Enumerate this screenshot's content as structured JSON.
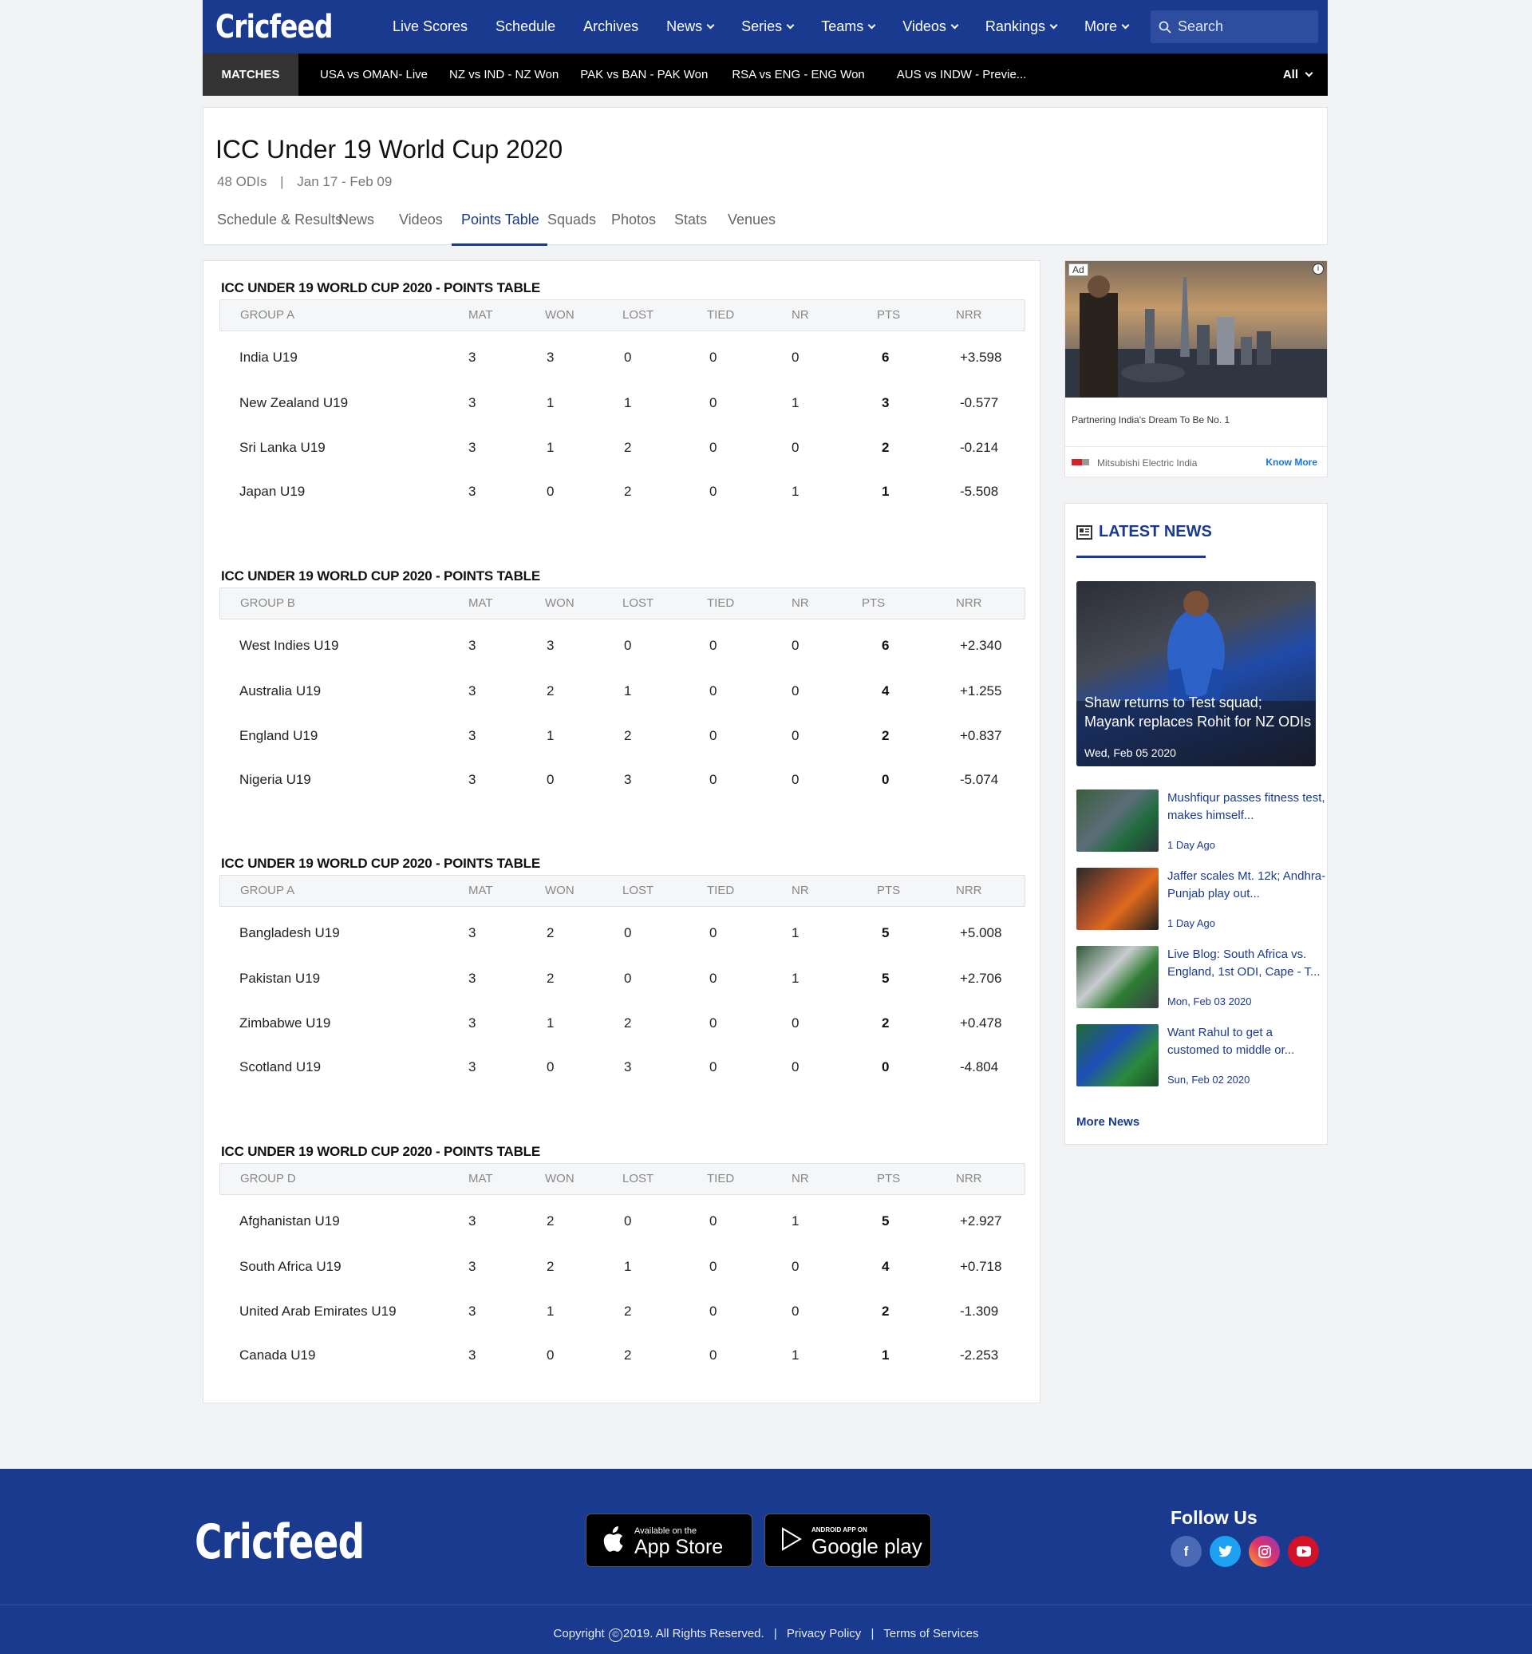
{
  "header": {
    "logo": "Cricfeed",
    "nav": [
      {
        "label": "Live Scores",
        "dropdown": false
      },
      {
        "label": "Schedule",
        "dropdown": false
      },
      {
        "label": "Archives",
        "dropdown": false
      },
      {
        "label": "News",
        "dropdown": true
      },
      {
        "label": "Series",
        "dropdown": true
      },
      {
        "label": "Teams",
        "dropdown": true
      },
      {
        "label": "Videos",
        "dropdown": true
      },
      {
        "label": "Rankings",
        "dropdown": true
      },
      {
        "label": "More",
        "dropdown": true
      }
    ],
    "search_placeholder": "Search"
  },
  "matchbar": {
    "label": "MATCHES",
    "matches": [
      "USA vs OMAN- Live",
      "NZ vs IND - NZ Won",
      "PAK vs BAN - PAK Won",
      "RSA vs  ENG - ENG Won",
      "AUS vs INDW - Previe..."
    ],
    "filter": "All"
  },
  "series": {
    "title": "ICC Under 19 World Cup 2020",
    "format": "48 ODIs",
    "separator": "|",
    "dates": "Jan 17 - Feb 09",
    "tabs": [
      "Schedule & Results",
      "News",
      "Videos",
      "Points Table",
      "Squads",
      "Photos",
      "Stats",
      "Venues"
    ],
    "active_tab": "Points Table"
  },
  "points_tables": [
    {
      "title": "ICC UNDER 19 WORLD CUP 2020 - POINTS TABLE",
      "group": "GROUP A",
      "columns": [
        "MAT",
        "WON",
        "LOST",
        "TIED",
        "NR",
        "PTS",
        "NRR"
      ],
      "rows": [
        {
          "team": "India U19",
          "mat": "3",
          "won": "3",
          "lost": "0",
          "tied": "0",
          "nr": "0",
          "pts": "6",
          "nrr": "+3.598"
        },
        {
          "team": "New Zealand U19",
          "mat": "3",
          "won": "1",
          "lost": "1",
          "tied": "0",
          "nr": "1",
          "pts": "3",
          "nrr": "-0.577"
        },
        {
          "team": "Sri Lanka U19",
          "mat": "3",
          "won": "1",
          "lost": "2",
          "tied": "0",
          "nr": "0",
          "pts": "2",
          "nrr": "-0.214"
        },
        {
          "team": "Japan U19",
          "mat": "3",
          "won": "0",
          "lost": "2",
          "tied": "0",
          "nr": "1",
          "pts": "1",
          "nrr": "-5.508"
        }
      ]
    },
    {
      "title": "ICC UNDER 19 WORLD CUP 2020 - POINTS TABLE",
      "group": "GROUP B",
      "columns": [
        "MAT",
        "WON",
        "LOST",
        "TIED",
        "NR",
        "PTS",
        "NRR"
      ],
      "rows": [
        {
          "team": "West Indies U19",
          "mat": "3",
          "won": "3",
          "lost": "0",
          "tied": "0",
          "nr": "0",
          "pts": "6",
          "nrr": "+2.340"
        },
        {
          "team": "Australia U19",
          "mat": "3",
          "won": "2",
          "lost": "1",
          "tied": "0",
          "nr": "0",
          "pts": "4",
          "nrr": "+1.255"
        },
        {
          "team": "England U19",
          "mat": "3",
          "won": "1",
          "lost": "2",
          "tied": "0",
          "nr": "0",
          "pts": "2",
          "nrr": "+0.837"
        },
        {
          "team": "Nigeria U19",
          "mat": "3",
          "won": "0",
          "lost": "3",
          "tied": "0",
          "nr": "0",
          "pts": "0",
          "nrr": "-5.074"
        }
      ]
    },
    {
      "title": "ICC UNDER 19 WORLD CUP 2020 - POINTS TABLE",
      "group": "GROUP A",
      "columns": [
        "MAT",
        "WON",
        "LOST",
        "TIED",
        "NR",
        "PTS",
        "NRR"
      ],
      "rows": [
        {
          "team": "Bangladesh U19",
          "mat": "3",
          "won": "2",
          "lost": "0",
          "tied": "0",
          "nr": "1",
          "pts": "5",
          "nrr": "+5.008"
        },
        {
          "team": "Pakistan U19",
          "mat": "3",
          "won": "2",
          "lost": "0",
          "tied": "0",
          "nr": "1",
          "pts": "5",
          "nrr": "+2.706"
        },
        {
          "team": "Zimbabwe U19",
          "mat": "3",
          "won": "1",
          "lost": "2",
          "tied": "0",
          "nr": "0",
          "pts": "2",
          "nrr": "+0.478"
        },
        {
          "team": "Scotland U19",
          "mat": "3",
          "won": "0",
          "lost": "3",
          "tied": "0",
          "nr": "0",
          "pts": "0",
          "nrr": "-4.804"
        }
      ]
    },
    {
      "title": "ICC UNDER 19 WORLD CUP 2020 - POINTS TABLE",
      "group": "GROUP D",
      "columns": [
        "MAT",
        "WON",
        "LOST",
        "TIED",
        "NR",
        "PTS",
        "NRR"
      ],
      "rows": [
        {
          "team": "Afghanistan U19",
          "mat": "3",
          "won": "2",
          "lost": "0",
          "tied": "0",
          "nr": "1",
          "pts": "5",
          "nrr": "+2.927"
        },
        {
          "team": "South Africa U19",
          "mat": "3",
          "won": "2",
          "lost": "1",
          "tied": "0",
          "nr": "0",
          "pts": "4",
          "nrr": "+0.718"
        },
        {
          "team": "United Arab Emirates U19",
          "mat": "3",
          "won": "1",
          "lost": "2",
          "tied": "0",
          "nr": "0",
          "pts": "2",
          "nrr": "-1.309"
        },
        {
          "team": "Canada U19",
          "mat": "3",
          "won": "0",
          "lost": "2",
          "tied": "0",
          "nr": "1",
          "pts": "1",
          "nrr": "-2.253"
        }
      ]
    }
  ],
  "ad": {
    "badge": "Ad",
    "info_icon": "info-icon",
    "text": "Partnering India's Dream To Be No. 1",
    "advertiser": "Mitsubishi Electric India",
    "cta": "Know More"
  },
  "latest_news": {
    "heading": "LATEST NEWS",
    "heading_icon": "newspaper-icon",
    "hero": {
      "title": "Shaw returns to Test squad; Mayank replaces Rohit for NZ ODIs",
      "date": "Wed, Feb 05 2020"
    },
    "items": [
      {
        "title": "Mushfiqur passes fitness test, makes himself...",
        "date": "1 Day Ago"
      },
      {
        "title": "Jaffer scales Mt. 12k; Andhra-Punjab play out...",
        "date": "1 Day Ago"
      },
      {
        "title": "Live Blog: South Africa vs. England, 1st ODI, Cape - T...",
        "date": "Mon, Feb 03 2020"
      },
      {
        "title": "Want Rahul to get a customed to middle or...",
        "date": "Sun, Feb 02 2020"
      }
    ],
    "more": "More News"
  },
  "footer": {
    "logo": "Cricfeed",
    "app_store": {
      "small": "Available on the",
      "big": "App Store"
    },
    "google_play": {
      "small": "ANDROID APP ON",
      "big": "Google play"
    },
    "follow": "Follow Us",
    "social": [
      "facebook-icon",
      "twitter-icon",
      "instagram-icon",
      "youtube-icon"
    ],
    "copyright": "Copyright",
    "copyright_symbol": "©",
    "copyright_rest": "2019. All Rights Reserved.",
    "privacy": "Privacy Policy",
    "terms": "Terms of Services",
    "divider": "|"
  },
  "colors": {
    "brand": "#1a3a8f",
    "matchbar": "#000000",
    "page_bg": "#f2f3f5"
  }
}
